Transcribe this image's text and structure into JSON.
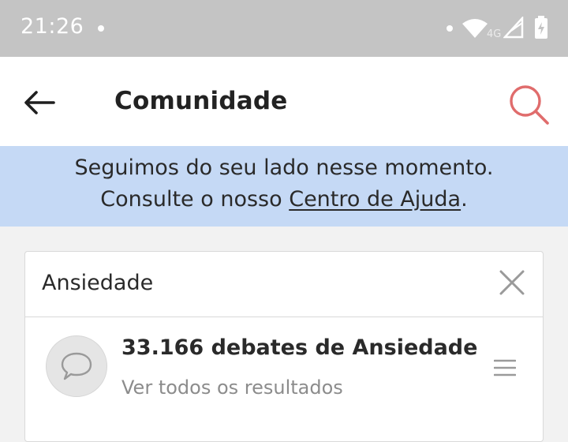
{
  "status_bar": {
    "time": "21:26",
    "network_label": "4G"
  },
  "header": {
    "title": "Comunidade"
  },
  "banner": {
    "line1": "Seguimos do seu lado nesse momento.",
    "line2_prefix": "Consulte o nosso ",
    "link_text": "Centro de Ajuda",
    "line2_suffix": "."
  },
  "search": {
    "value": "Ansiedade"
  },
  "result": {
    "title": "33.166 debates de Ansiedade",
    "subtitle": "Ver todos os resultados"
  },
  "colors": {
    "status_bar_bg": "#c4c4c4",
    "banner_bg": "#c5d9f5",
    "search_icon": "#e06c6c",
    "page_bg": "#f2f2f2"
  },
  "icons": {
    "back": "arrow-left-icon",
    "search": "search-icon",
    "clear": "close-icon",
    "result": "chat-bubble-icon",
    "menu": "menu-icon"
  }
}
